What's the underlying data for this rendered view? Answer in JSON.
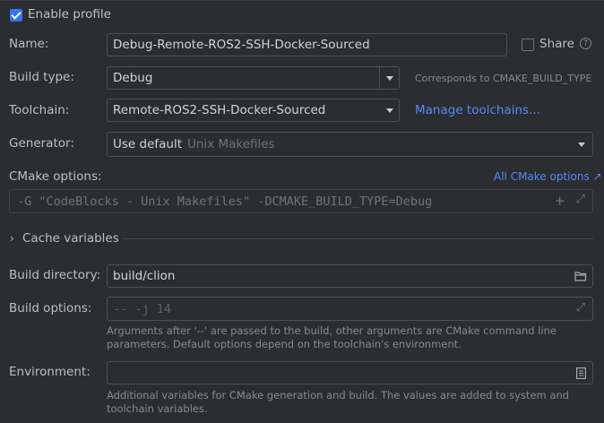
{
  "profile": {
    "enable_label": "Enable profile",
    "enabled": true
  },
  "name": {
    "label": "Name:",
    "value": "Debug-Remote-ROS2-SSH-Docker-Sourced",
    "share_label": "Share",
    "share_checked": false
  },
  "build_type": {
    "label": "Build type:",
    "value": "Debug",
    "hint": "Corresponds to CMAKE_BUILD_TYPE"
  },
  "toolchain": {
    "label": "Toolchain:",
    "value": "Remote-ROS2-SSH-Docker-Sourced",
    "manage_link": "Manage toolchains..."
  },
  "generator": {
    "label": "Generator:",
    "value": "Use default",
    "secondary": "Unix Makefiles"
  },
  "cmake_options": {
    "label": "CMake options:",
    "all_link": "All CMake options ↗",
    "value": "-G \"CodeBlocks - Unix Makefiles\" -DCMAKE_BUILD_TYPE=Debug"
  },
  "cache": {
    "label": "Cache variables"
  },
  "build_directory": {
    "label": "Build directory:",
    "value": "build/clion"
  },
  "build_options": {
    "label": "Build options:",
    "placeholder": "-- -j 14",
    "hint_line1": "Arguments after '--' are passed to the build, other arguments are CMake command line",
    "hint_line2": "parameters. Default options depend on the toolchain's environment."
  },
  "environment": {
    "label": "Environment:",
    "value": "",
    "hint_line1": "Additional variables for CMake generation and build. The values are added to system and",
    "hint_line2": "toolchain variables."
  },
  "colors": {
    "background": "#2b2d30",
    "link": "#548af7",
    "accent": "#3574f0"
  }
}
